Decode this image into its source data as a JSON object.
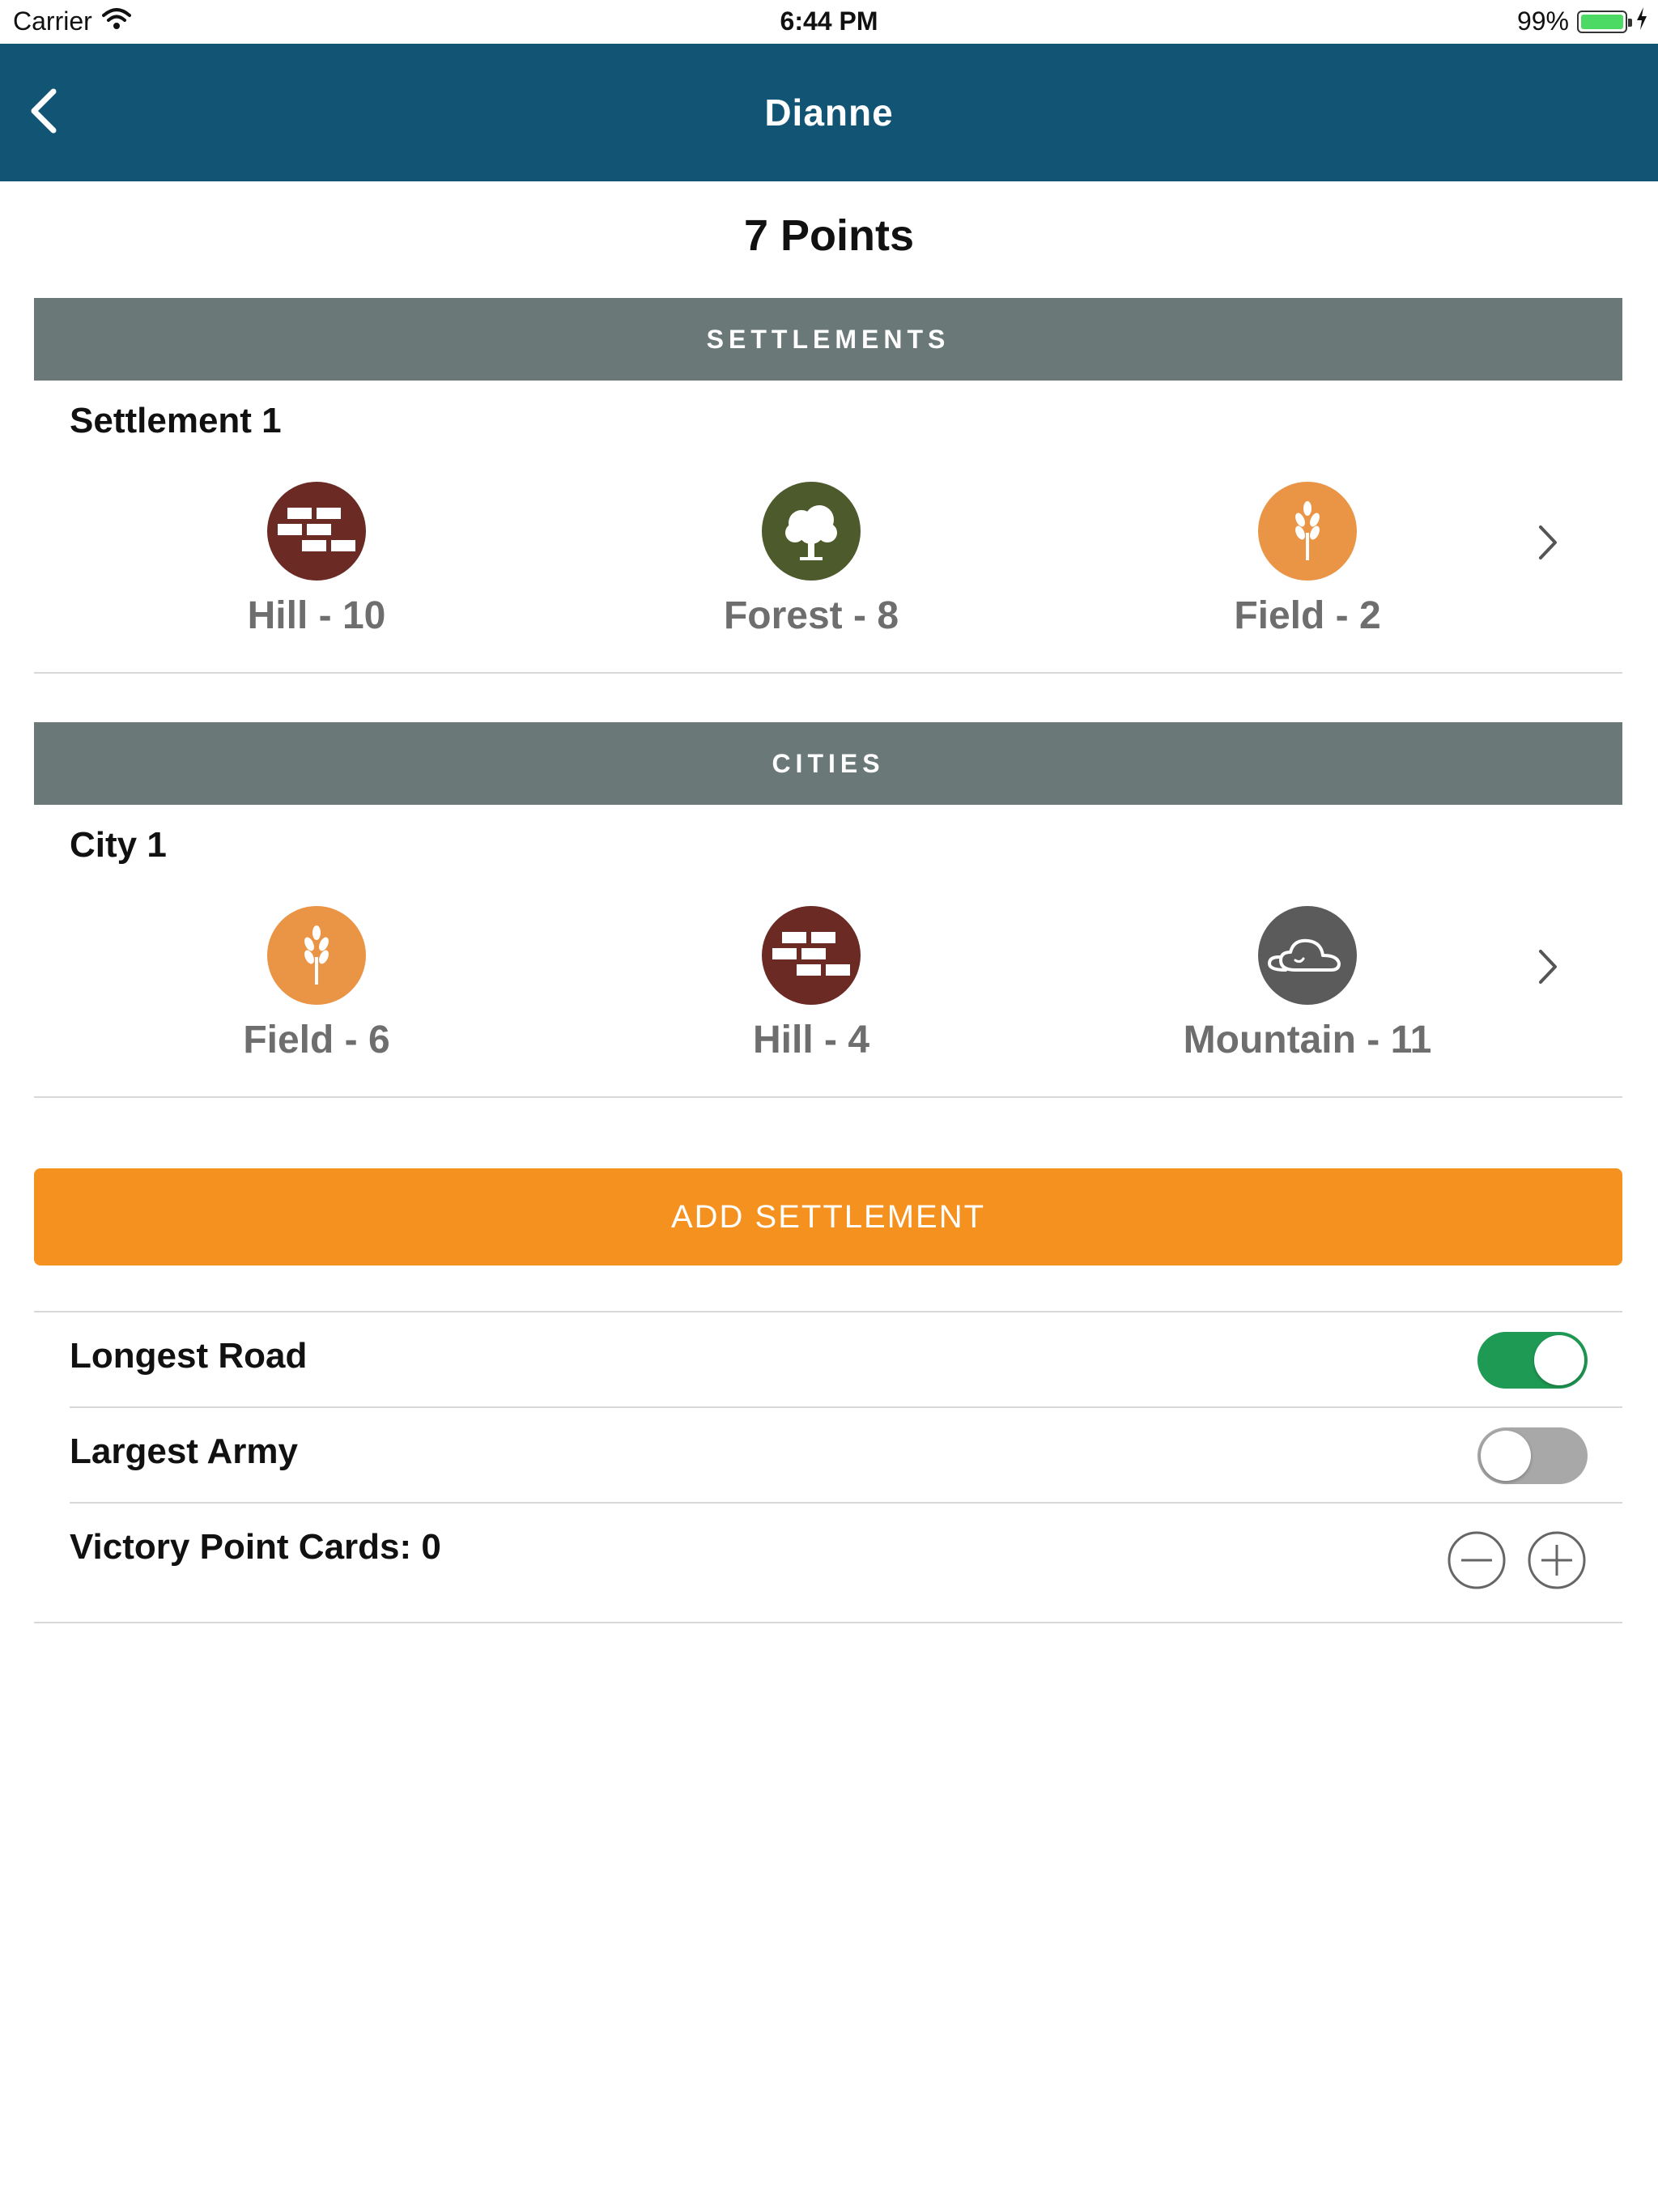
{
  "status_bar": {
    "carrier": "Carrier",
    "time": "6:44 PM",
    "battery": "99%",
    "battery_level": 0.99
  },
  "nav": {
    "title": "Dianne",
    "back_icon": "chevron-left-icon"
  },
  "points_label": "7 Points",
  "settlements": {
    "header": "SETTLEMENTS",
    "items": [
      {
        "title": "Settlement 1",
        "resources": [
          {
            "label": "Hill - 10",
            "icon": "brick-icon",
            "color": "#6b2a24"
          },
          {
            "label": "Forest - 8",
            "icon": "tree-icon",
            "color": "#4d5a2c"
          },
          {
            "label": "Field - 2",
            "icon": "wheat-icon",
            "color": "#ea9446"
          }
        ]
      }
    ]
  },
  "cities": {
    "header": "CITIES",
    "items": [
      {
        "title": "City 1",
        "resources": [
          {
            "label": "Field - 6",
            "icon": "wheat-icon",
            "color": "#ea9446"
          },
          {
            "label": "Hill - 4",
            "icon": "brick-icon",
            "color": "#6b2a24"
          },
          {
            "label": "Mountain - 11",
            "icon": "cloud-icon",
            "color": "#5b5b5b"
          }
        ]
      }
    ]
  },
  "add_button_label": "ADD SETTLEMENT",
  "longest_road": {
    "label": "Longest Road",
    "on": true
  },
  "largest_army": {
    "label": "Largest Army",
    "on": false
  },
  "victory_points": {
    "label": "Victory Point Cards: 0"
  },
  "colors": {
    "nav": "#125474",
    "section_header": "#6a7878",
    "accent_orange": "#f5911e",
    "toggle_on": "#1f9a54"
  }
}
